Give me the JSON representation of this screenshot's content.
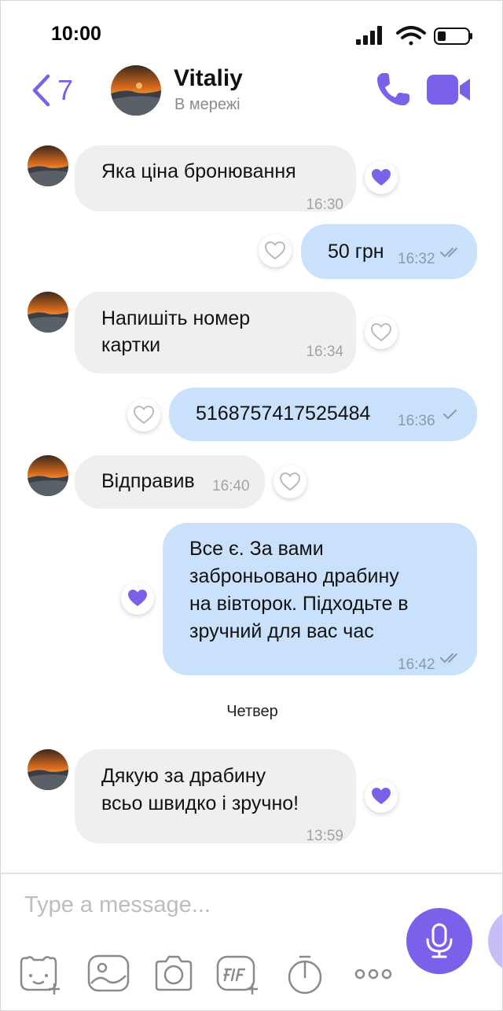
{
  "status_bar": {
    "time": "10:00"
  },
  "header": {
    "back_count": "7",
    "contact_name": "Vitaliy",
    "contact_status": "В мережі"
  },
  "messages": [
    {
      "direction": "in",
      "lines": [
        "Яка ціна бронювання"
      ],
      "time": "16:30",
      "liked": true
    },
    {
      "direction": "out",
      "lines": [
        "50 грн"
      ],
      "time": "16:32",
      "liked": false
    },
    {
      "direction": "in",
      "lines": [
        "Напишіть номер",
        "картки"
      ],
      "time": "16:34",
      "liked": false
    },
    {
      "direction": "out",
      "lines": [
        "5168757417525484"
      ],
      "time": "16:36",
      "liked": false
    },
    {
      "direction": "in",
      "lines": [
        "Відправив"
      ],
      "time": "16:40",
      "liked": false
    },
    {
      "direction": "out",
      "lines": [
        "Все є. За вами",
        "заброньовано драбину",
        "на вівторок. Підходьте в",
        "зручний для вас час"
      ],
      "time": "16:42",
      "liked": true
    },
    {
      "direction": "in",
      "lines": [
        "Дякую за драбину",
        "всьо швидко і зручно!"
      ],
      "time": "13:59",
      "liked": true
    }
  ],
  "day_separator": "Четвер",
  "composer": {
    "placeholder": "Type a message...",
    "tools": [
      "sticker-icon",
      "gallery-icon",
      "camera-icon",
      "gif-icon",
      "timer-icon",
      "more-icon"
    ]
  },
  "colors": {
    "accent": "#7b61ea",
    "incoming_bubble": "#efefef",
    "outgoing_bubble": "#c9e1fb"
  }
}
